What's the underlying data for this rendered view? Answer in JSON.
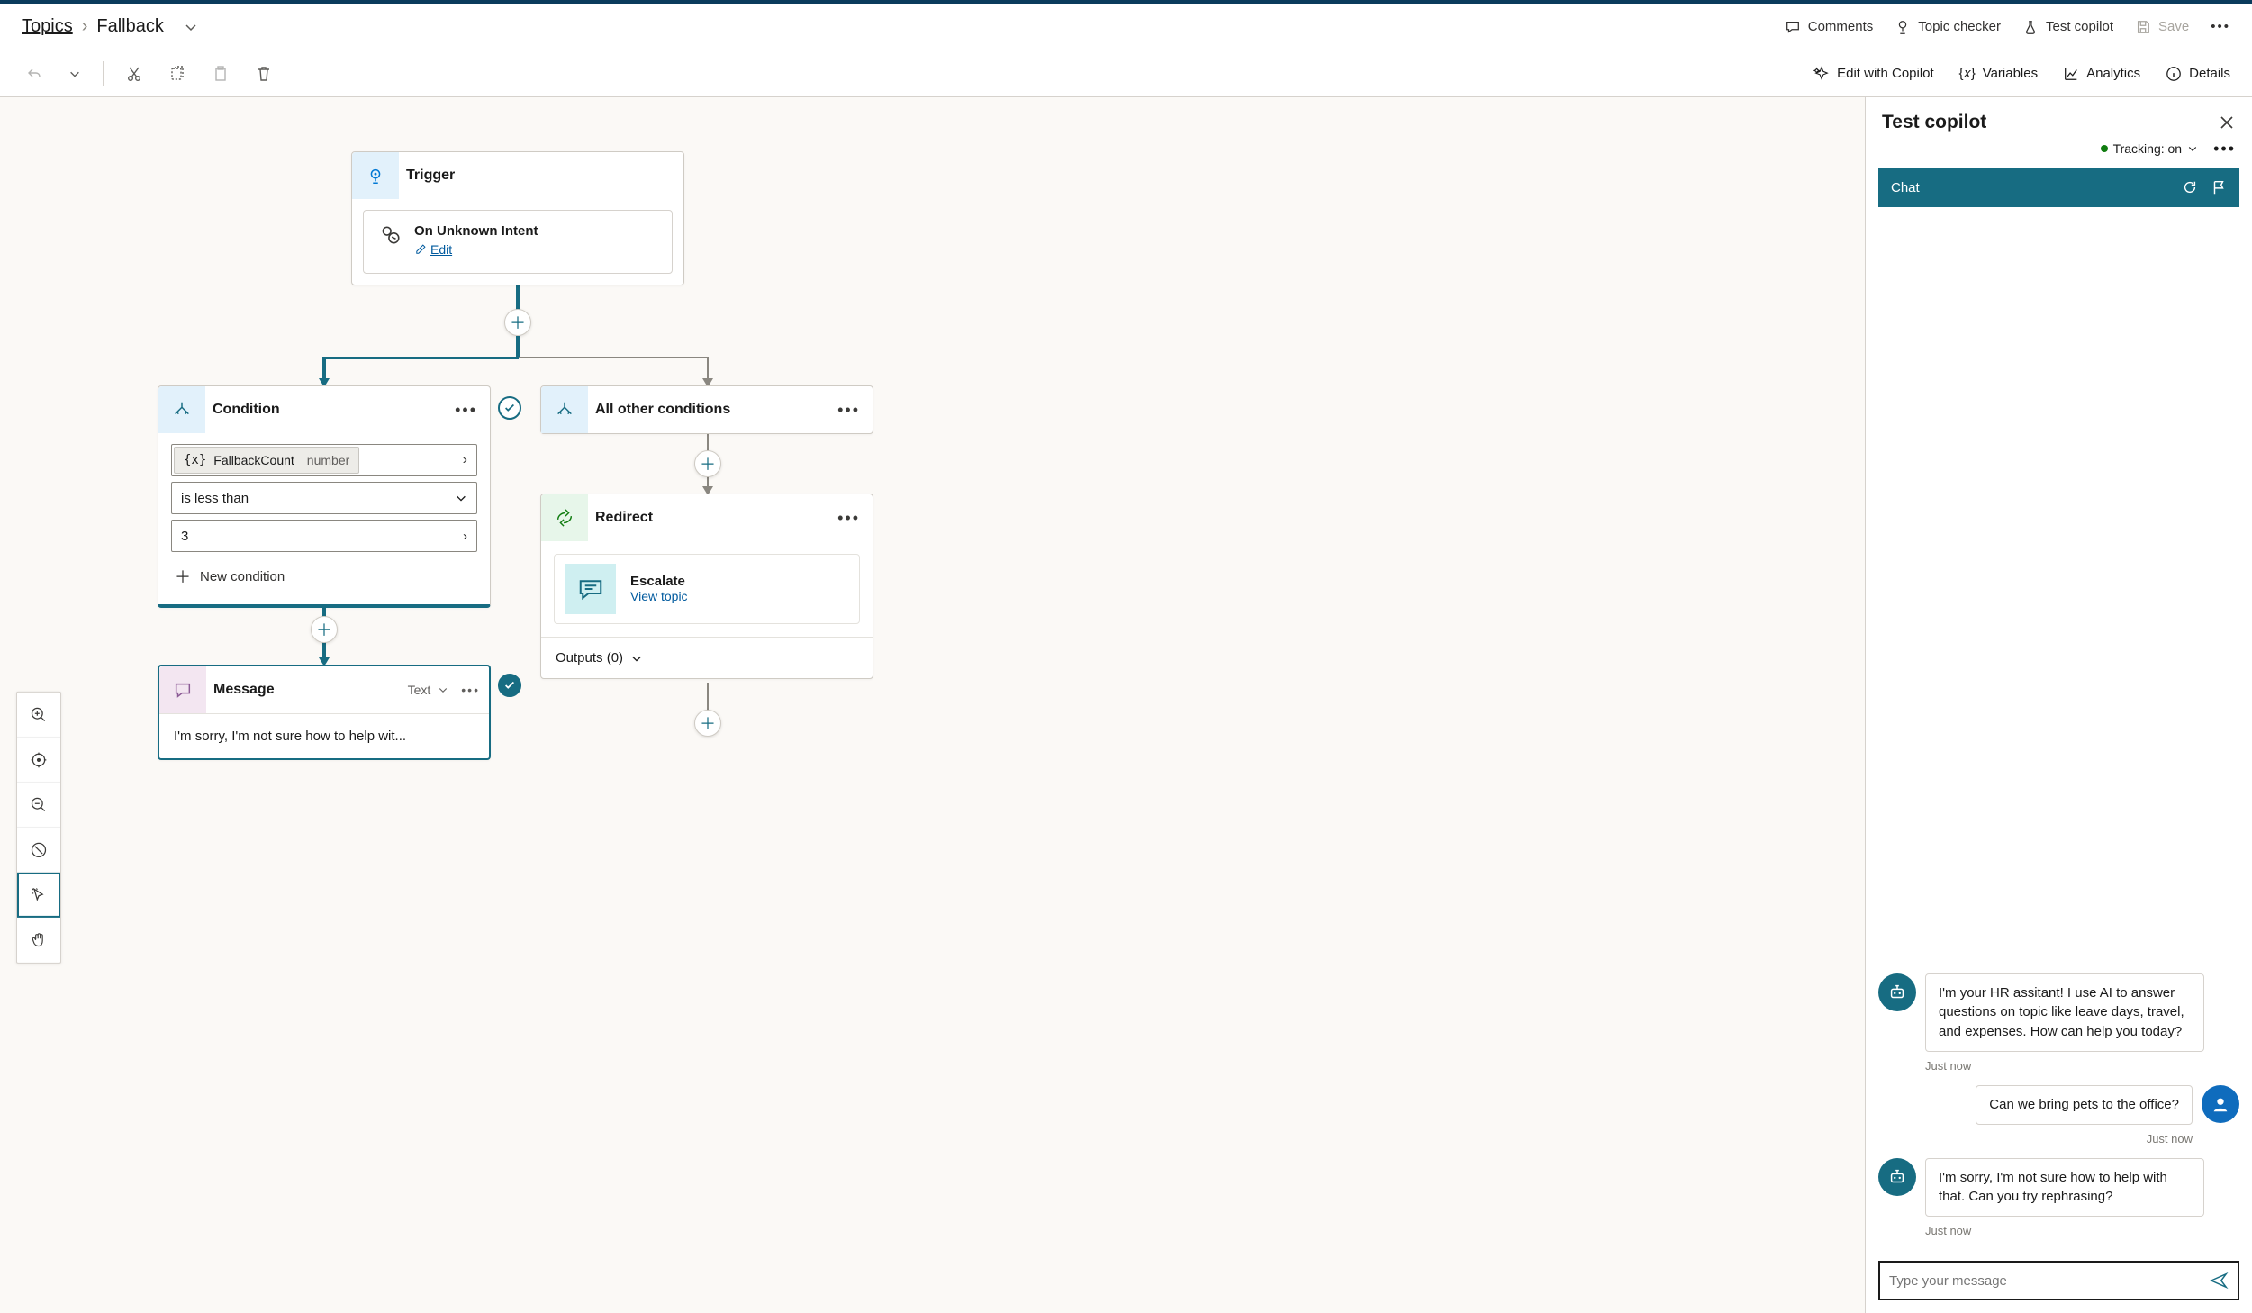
{
  "breadcrumb": {
    "root": "Topics",
    "current": "Fallback"
  },
  "topbar": {
    "comments": "Comments",
    "topic_checker": "Topic checker",
    "test_copilot": "Test copilot",
    "save": "Save"
  },
  "toolbar": {
    "edit_with_copilot": "Edit with Copilot",
    "variables": "Variables",
    "analytics": "Analytics",
    "details": "Details"
  },
  "trigger": {
    "label": "Trigger",
    "event": "On Unknown Intent",
    "edit": "Edit"
  },
  "condition": {
    "label": "Condition",
    "var_name": "FallbackCount",
    "var_type": "number",
    "operator": "is less than",
    "value": "3",
    "new_condition": "New condition"
  },
  "all_other": {
    "label": "All other conditions"
  },
  "redirect": {
    "label": "Redirect",
    "target": "Escalate",
    "view_topic": "View topic",
    "outputs_label": "Outputs (0)"
  },
  "message": {
    "label": "Message",
    "type_label": "Text",
    "preview": "I'm sorry, I'm not sure how to help wit..."
  },
  "test_panel": {
    "title": "Test copilot",
    "tracking": "Tracking: on",
    "chat_label": "Chat",
    "bot_msg_1": "I'm your HR assitant! I use AI to answer questions on topic like leave days, travel, and expenses. How can help you today?",
    "ts_1": "Just now",
    "user_msg_1": "Can we bring pets to the office?",
    "ts_2": "Just now",
    "bot_msg_2": "I'm sorry, I'm not sure how to help with that. Can you try rephrasing?",
    "ts_3": "Just now",
    "input_placeholder": "Type your message"
  }
}
